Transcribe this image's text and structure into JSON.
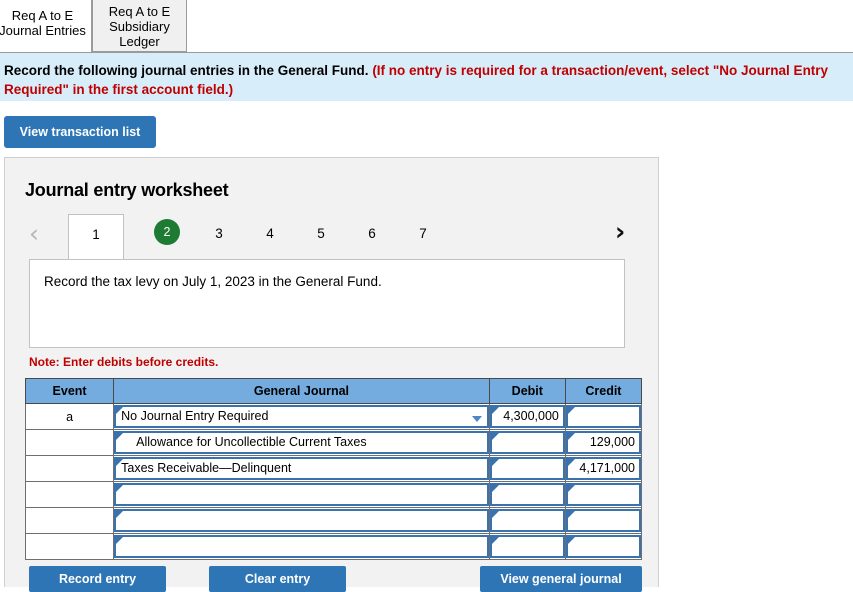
{
  "tabs": [
    {
      "label": "Req A to E\nJournal Entries",
      "line1": "Req A to E",
      "line2": "Journal Entries",
      "active": true
    },
    {
      "label": "Req A to E Subsidiary Ledger",
      "line1": "Req A to E",
      "line2": "Subsidiary",
      "line3": "Ledger",
      "active": false
    }
  ],
  "banner": {
    "lead": "Record the following journal entries in the General Fund.",
    "requirement": "(If no entry is required for a transaction/event, select \"No Journal Entry Required\" in the first account field.)"
  },
  "toolbar": {
    "view_transaction_list": "View transaction list"
  },
  "panel": {
    "title": "Journal entry worksheet",
    "prompt": "Record the tax levy on July 1, 2023 in the General Fund.",
    "note": "Note: Enter debits before credits."
  },
  "pager": {
    "prev_icon": "‹",
    "next_icon": "›",
    "pages": [
      "1",
      "2",
      "3",
      "4",
      "5",
      "6",
      "7"
    ],
    "tab_page": "1",
    "current_page": "2"
  },
  "table": {
    "headers": [
      "Event",
      "General Journal",
      "Debit",
      "Credit"
    ],
    "rows": [
      {
        "event": "a",
        "account": "No Journal Entry Required",
        "indented": false,
        "dropdown": true,
        "debit": "4,300,000",
        "credit": ""
      },
      {
        "event": "",
        "account": "Allowance for Uncollectible Current Taxes",
        "indented": true,
        "dropdown": false,
        "debit": "",
        "credit": "129,000"
      },
      {
        "event": "",
        "account": "Taxes Receivable—Delinquent",
        "indented": false,
        "dropdown": false,
        "debit": "",
        "credit": "4,171,000"
      },
      {
        "event": "",
        "account": "",
        "indented": false,
        "dropdown": false,
        "debit": "",
        "credit": ""
      },
      {
        "event": "",
        "account": "",
        "indented": false,
        "dropdown": false,
        "debit": "",
        "credit": ""
      },
      {
        "event": "",
        "account": "",
        "indented": false,
        "dropdown": false,
        "debit": "",
        "credit": ""
      }
    ]
  },
  "actions": {
    "record_entry": "Record entry",
    "clear_entry": "Clear entry",
    "view_general_journal": "View general journal"
  },
  "colors": {
    "accent_blue": "#2e75b6",
    "banner_blue": "#d7edf9",
    "alert_red": "#c00000",
    "header_blue": "#74ace0",
    "current_page_green": "#1e7b33",
    "field_border_blue": "#3a72b0"
  }
}
